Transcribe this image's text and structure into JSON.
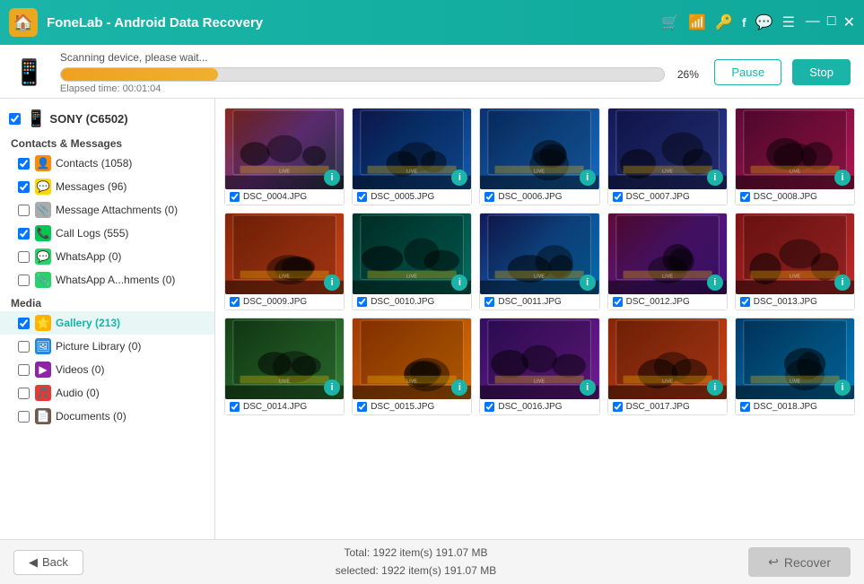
{
  "titlebar": {
    "logo": "🏠",
    "title": "FoneLab - Android Data Recovery",
    "icons": [
      "🛒",
      "📶",
      "🔑",
      "f",
      "💬",
      "☰"
    ],
    "controls": [
      "—",
      "□",
      "✕"
    ]
  },
  "scanbar": {
    "status_text": "Scanning device, please wait...",
    "progress_pct": 26,
    "progress_label": "26%",
    "elapsed_label": "Elapsed time: 00:01:04",
    "pause_btn": "Pause",
    "stop_btn": "Stop"
  },
  "sidebar": {
    "device": {
      "name": "SONY (C6502)"
    },
    "sections": [
      {
        "label": "Contacts & Messages",
        "items": [
          {
            "name": "Contacts",
            "count": "(1058)",
            "icon": "👤",
            "icon_class": "icon-contacts",
            "checked": true
          },
          {
            "name": "Messages",
            "count": "(96)",
            "icon": "💬",
            "icon_class": "icon-messages",
            "checked": true
          },
          {
            "name": "Message Attachments",
            "count": "(0)",
            "icon": "📎",
            "icon_class": "icon-msgatt",
            "checked": false
          },
          {
            "name": "Call Logs",
            "count": "(555)",
            "icon": "📞",
            "icon_class": "icon-calllogs",
            "checked": true
          },
          {
            "name": "WhatsApp",
            "count": "(0)",
            "icon": "💬",
            "icon_class": "icon-whatsapp",
            "checked": false
          },
          {
            "name": "WhatsApp A...hments",
            "count": "(0)",
            "icon": "📎",
            "icon_class": "icon-whatsapp",
            "checked": false
          }
        ]
      },
      {
        "label": "Media",
        "items": [
          {
            "name": "Gallery",
            "count": "(213)",
            "icon": "⭐",
            "icon_class": "icon-gallery",
            "checked": true,
            "active": true
          },
          {
            "name": "Picture Library",
            "count": "(0)",
            "icon": "🖼",
            "icon_class": "icon-piclibrary",
            "checked": false
          },
          {
            "name": "Videos",
            "count": "(0)",
            "icon": "▶",
            "icon_class": "icon-videos",
            "checked": false
          },
          {
            "name": "Audio",
            "count": "(0)",
            "icon": "🎵",
            "icon_class": "icon-audio",
            "checked": false
          },
          {
            "name": "Documents",
            "count": "(0)",
            "icon": "📄",
            "icon_class": "icon-documents",
            "checked": false
          }
        ]
      }
    ]
  },
  "photos": [
    {
      "name": "DSC_0004.JPG",
      "bg": "photo-bg-1",
      "checked": true
    },
    {
      "name": "DSC_0005.JPG",
      "bg": "photo-bg-2",
      "checked": true
    },
    {
      "name": "DSC_0006.JPG",
      "bg": "photo-bg-3",
      "checked": true
    },
    {
      "name": "DSC_0007.JPG",
      "bg": "photo-bg-4",
      "checked": true
    },
    {
      "name": "DSC_0008.JPG",
      "bg": "photo-bg-5",
      "checked": true
    },
    {
      "name": "DSC_0009.JPG",
      "bg": "photo-bg-6",
      "checked": true
    },
    {
      "name": "DSC_0010.JPG",
      "bg": "photo-bg-7",
      "checked": true
    },
    {
      "name": "DSC_0011.JPG",
      "bg": "photo-bg-8",
      "checked": true
    },
    {
      "name": "DSC_0012.JPG",
      "bg": "photo-bg-9",
      "checked": true
    },
    {
      "name": "DSC_0013.JPG",
      "bg": "photo-bg-10",
      "checked": true
    },
    {
      "name": "DSC_0014.JPG",
      "bg": "photo-bg-11",
      "checked": true
    },
    {
      "name": "DSC_0015.JPG",
      "bg": "photo-bg-12",
      "checked": true
    },
    {
      "name": "DSC_0016.JPG",
      "bg": "photo-bg-13",
      "checked": true
    },
    {
      "name": "DSC_0017.JPG",
      "bg": "photo-bg-14",
      "checked": true
    },
    {
      "name": "DSC_0018.JPG",
      "bg": "photo-bg-15",
      "checked": true
    }
  ],
  "bottombar": {
    "back_label": "Back",
    "total_label": "Total: 1922 item(s)  191.07 MB",
    "selected_label": "selected: 1922 item(s)  191.07 MB",
    "recover_label": "Recover"
  }
}
